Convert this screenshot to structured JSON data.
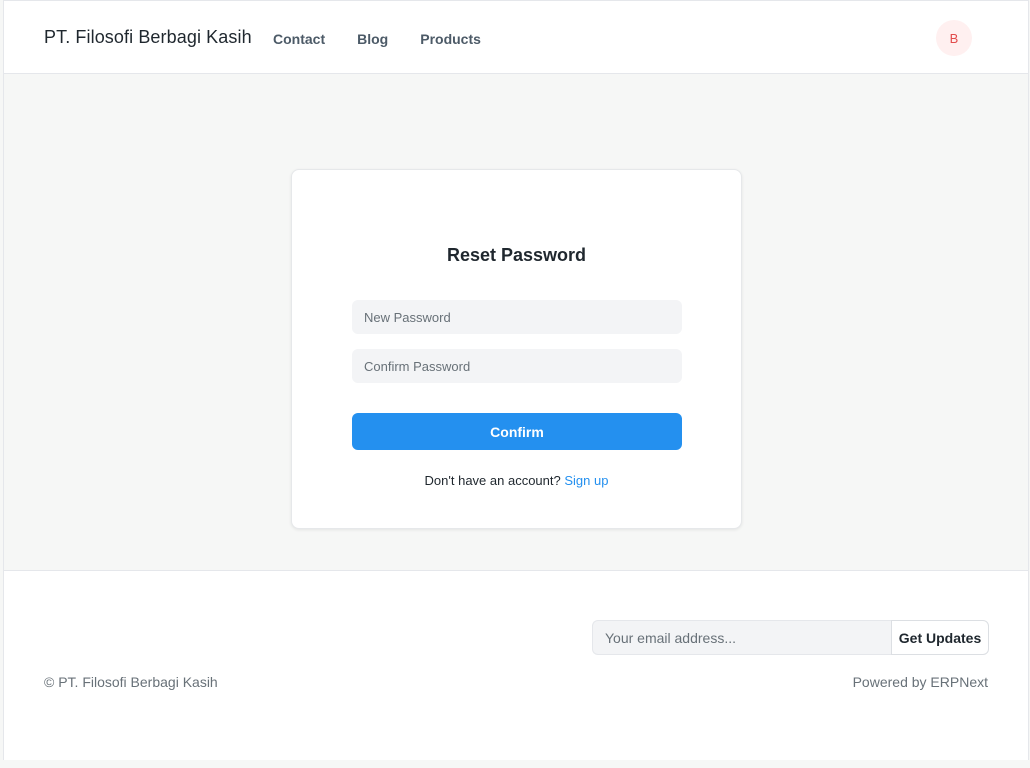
{
  "navbar": {
    "brand": "PT. Filosofi Berbagi Kasih",
    "links": [
      {
        "label": "Contact"
      },
      {
        "label": "Blog"
      },
      {
        "label": "Products"
      }
    ],
    "avatar_initial": "B"
  },
  "reset_form": {
    "title": "Reset Password",
    "new_password_placeholder": "New Password",
    "confirm_password_placeholder": "Confirm Password",
    "confirm_label": "Confirm",
    "signup_prompt": "Don't have an account?",
    "signup_link": "Sign up"
  },
  "footer": {
    "email_placeholder": "Your email address...",
    "updates_label": "Get Updates",
    "copyright": "© PT. Filosofi Berbagi Kasih",
    "powered_prefix": "Powered by",
    "powered_link": "ERPNext"
  },
  "colors": {
    "accent": "#2490ef",
    "avatar_bg": "#fff0f0",
    "avatar_text": "#e24c4c",
    "page_bg": "#f6f7f6"
  }
}
